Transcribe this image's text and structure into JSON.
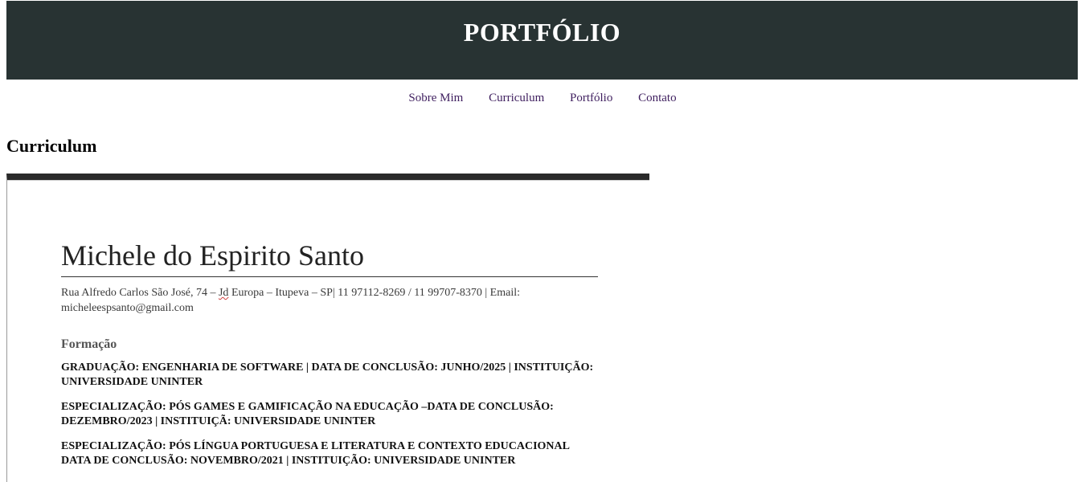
{
  "header": {
    "title": "PORTFÓLIO"
  },
  "nav": {
    "items": [
      "Sobre Mim",
      "Curriculum",
      "Portfólio",
      "Contato"
    ]
  },
  "section": {
    "title": "Curriculum"
  },
  "resume": {
    "name": "Michele do Espirito Santo",
    "contact_before_flag": "Rua Alfredo Carlos São José, 74 – ",
    "contact_flagged_word": "Jd",
    "contact_after_flag": " Europa – Itupeva – SP| 11 97112-8269 / 11 99707-8370  | Email: micheleespsanto@gmail.com",
    "education_heading": "Formação",
    "education": [
      "GRADUAÇÃO: ENGENHARIA DE SOFTWARE  | DATA DE CONCLUSÃO: JUNHO/2025 | INSTITUIÇÃO: UNIVERSIDADE UNINTER",
      "ESPECIALIZAÇÃO: PÓS GAMES E GAMIFICAÇÃO NA EDUCAÇÃO –DATA DE CONCLUSÃO: DEZEMBRO/2023 | INSTITUIÇÃ: UNIVERSIDADE UNINTER",
      "ESPECIALIZAÇÃO: PÓS LÍNGUA PORTUGUESA E LITERATURA E CONTEXTO EDUCACIONAL DATA DE CONCLUSÃO: NOVEMBRO/2021 | INSTITUIÇÃO: UNIVERSIDADE UNINTER"
    ]
  },
  "colors": {
    "header_bg": "#283333",
    "nav_link": "#3f1f5f",
    "doc_top_bar": "#2a2a2a"
  }
}
